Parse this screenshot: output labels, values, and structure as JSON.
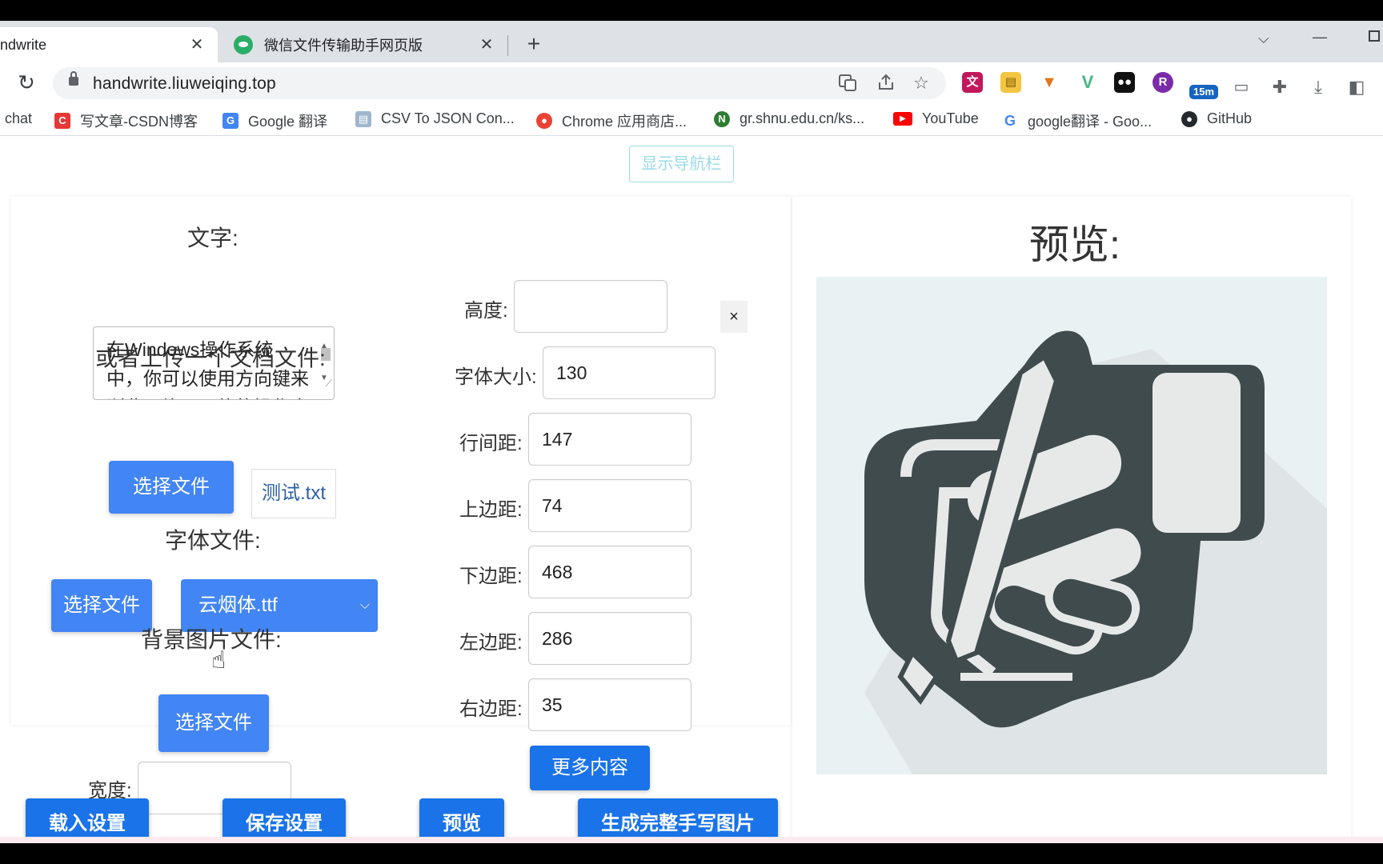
{
  "browser": {
    "tabs": [
      {
        "title": "ndwrite",
        "close": "✕"
      },
      {
        "title": "微信文件传输助手网页版",
        "close": "✕"
      }
    ],
    "new_tab": "+",
    "url": "handwrite.liuweiqing.top",
    "extension_badge": "15m",
    "bookmarks": [
      {
        "label": "chat",
        "icon": "none"
      },
      {
        "label": "写文章-CSDN博客",
        "icon": "csdn-icon"
      },
      {
        "label": "Google 翻译",
        "icon": "google-translate-icon"
      },
      {
        "label": "CSV To JSON Con...",
        "icon": "csv-icon"
      },
      {
        "label": "Chrome 应用商店...",
        "icon": "chrome-web-store-icon"
      },
      {
        "label": "gr.shnu.edu.cn/ks...",
        "icon": "shnu-icon"
      },
      {
        "label": "YouTube",
        "icon": "youtube-icon"
      },
      {
        "label": "google翻译 - Goo...",
        "icon": "google-icon"
      },
      {
        "label": "GitHub",
        "icon": "github-icon"
      }
    ]
  },
  "page": {
    "nav_toggle": "显示导航栏",
    "text_label": "文字:",
    "text_content": "在Windows操作系统中，你可以使用方向键来浏览图片，具体的操作方法如下",
    "upload_doc_label": "或者上传一个文档文件:",
    "choose_file": "选择文件",
    "selected_doc": "测试.txt",
    "font_file_label": "字体文件:",
    "font_select": "云烟体.ttf",
    "bg_image_label": "背景图片文件:",
    "width_label": "宽度:",
    "width_value": "",
    "height_label": "高度:",
    "height_value": "",
    "close_symbol": "×",
    "font_size_label": "字体大小:",
    "font_size_value": "130",
    "line_spacing_label": "行间距:",
    "line_spacing_value": "147",
    "top_margin_label": "上边距:",
    "top_margin_value": "74",
    "bottom_margin_label": "下边距:",
    "bottom_margin_value": "468",
    "left_margin_label": "左边距:",
    "left_margin_value": "286",
    "right_margin_label": "右边距:",
    "right_margin_value": "35",
    "more_button": "更多内容",
    "load_settings": "载入设置",
    "save_settings": "保存设置",
    "preview_button": "预览",
    "generate_button": "生成完整手写图片",
    "preview_title": "预览:",
    "preview_image": "handwriting-hand-pen-icon"
  },
  "colors": {
    "accent": "#4285f4",
    "accent_dark": "#1a73e8",
    "nav_toggle_color": "#9adbe6",
    "icon_dark": "#3f4b4c"
  }
}
